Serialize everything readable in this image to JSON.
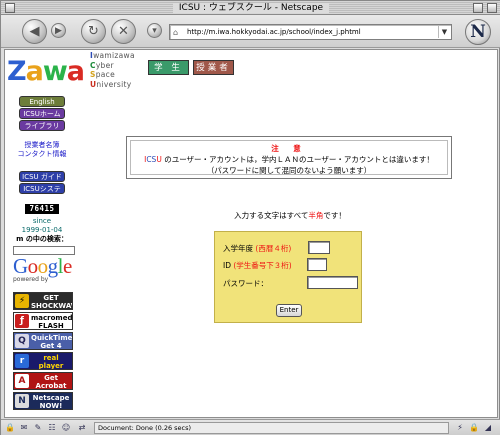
{
  "window": {
    "title": "ICSU : ウェブスクール - Netscape"
  },
  "toolbar": {
    "url": "http://m.iwa.hokkyodai.ac.jp/school/index_j.phtml",
    "back_icon": "back-arrow-icon",
    "forward_icon": "forward-arrow-icon",
    "reload_icon": "reload-icon",
    "stop_icon": "stop-icon",
    "logo": "N"
  },
  "header": {
    "logo": "Zawa",
    "acronym": [
      {
        "initial": "I",
        "rest": "wamizawa",
        "color": "#2c4bb5"
      },
      {
        "initial": "C",
        "rest": "yber",
        "color": "#1c8a3a"
      },
      {
        "initial": "S",
        "rest": "pace",
        "color": "#d4a11a"
      },
      {
        "initial": "U",
        "rest": "niversity",
        "color": "#c93020"
      }
    ],
    "student_button": "学 生",
    "teacher_button": "授業者",
    "colors": {
      "student": "#3a9a6a",
      "teacher": "#a0584a"
    }
  },
  "sidebar": {
    "english": "English",
    "icsu_home": "ICSUホーム",
    "library": "ライブラリ",
    "teacher_list": "授業者名簿",
    "contact": "コンタクト情報",
    "icsu_guide": "ICSU ガイド",
    "icsu_system": "ICSUシステム",
    "counter": "76415",
    "since_label": "since",
    "since_date": "1999-01-04",
    "search_label": "m の中の検索：",
    "google": "Google",
    "powered_by": "powered by",
    "badges": [
      {
        "name": "shockwave",
        "text": "GET SHOCKWAVE",
        "bg": "#2b2b2b"
      },
      {
        "name": "flash",
        "text": "macromedia FLASH PLAYER",
        "bg": "#ffffff"
      },
      {
        "name": "quicktime",
        "text": "QuickTime Get 4",
        "bg": "#4a5fa8"
      },
      {
        "name": "realplayer",
        "text": "real player FREE",
        "bg": "#1a1a6a"
      },
      {
        "name": "acrobat",
        "text": "Get Acrobat Reader",
        "bg": "#b01414"
      },
      {
        "name": "netscape",
        "text": "Netscape NOW!",
        "bg": "#1b2a5a"
      }
    ]
  },
  "notice": {
    "title": "注 意",
    "line1_prefix": "I",
    "line1_cs": "CS",
    "line1_u": "U",
    "line1_rest": " のユーザー・アカウントは，学内ＬＡＮのユーザー・アカウントとは違います！",
    "line2": "（パスワードに関して混同のないよう願います）"
  },
  "intro": {
    "prefix": "入力する文字はすべて",
    "highlight": "半角",
    "suffix": "です！"
  },
  "login": {
    "year_label": "入学年度 ",
    "year_hint": "(西暦４桁)",
    "year_value": "",
    "id_label": "ID ",
    "id_hint": "(学生番号下３桁)",
    "id_value": "",
    "password_label": "パスワード：",
    "password_value": "",
    "enter": "Enter",
    "bg": "#f1e37a"
  },
  "statusbar": {
    "text": "Document: Done (0.26 secs)"
  }
}
